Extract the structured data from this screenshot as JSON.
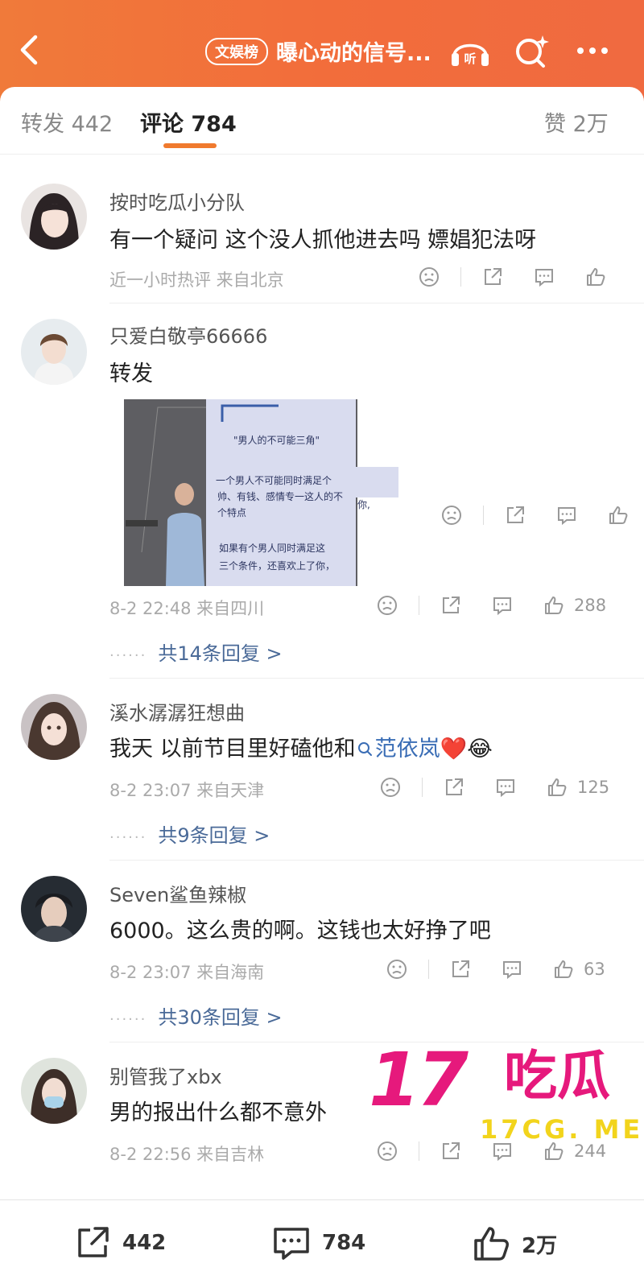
{
  "header": {
    "tag": "文娱榜",
    "title": "曝心动的信号...",
    "listen_label": "听"
  },
  "tabs": {
    "repost": "转发 442",
    "comments": "评论 784",
    "likes": "赞 2万"
  },
  "comments": [
    {
      "user": "按时吃瓜小分队",
      "text": "有一个疑问 这个没人抓他进去吗 嫖娼犯法呀",
      "meta": "近一小时热评  来自北京",
      "likes": ""
    },
    {
      "user": "只爱白敬亭66666",
      "text": "转发",
      "meta": "8-2 22:48  来自四川",
      "likes": "288",
      "replies": "共14条回复 >",
      "image": {
        "heading": "\"男人的不可能三角\"",
        "line1": "一个男人不可能同时满足个",
        "line2": "帅、有钱、感情专一这人的不",
        "line3": "个特点",
        "line3b": "你,",
        "line4": "如果有个男人同时满足这",
        "line5": "三个条件，还喜欢上了你，"
      }
    },
    {
      "user": "溪水潺潺狂想曲",
      "text_prefix": "我天  以前节目里好磕他和",
      "topic": "范依岚",
      "emoji": "❤️😂",
      "meta": "8-2 23:07  来自天津",
      "likes": "125",
      "replies": "共9条回复 >"
    },
    {
      "user": "Seven鲨鱼辣椒",
      "text": "6000。这么贵的啊。这钱也太好挣了吧",
      "meta": "8-2 23:07  来自海南",
      "likes": "63",
      "replies": "共30条回复 >"
    },
    {
      "user": "别管我了xbx",
      "text": "男的报出什么都不意外",
      "meta": "8-2 22:56  来自吉林",
      "likes": "244"
    }
  ],
  "bottom": {
    "reposts": "442",
    "comments": "784",
    "likes": "2万"
  },
  "watermark": {
    "number": "17",
    "cn": "吃瓜",
    "site": "17CG. ME"
  },
  "colors": {
    "header": "#f07a3a",
    "accent": "#f07a2e",
    "link": "#4a6a98",
    "watermark_pink": "#e6197c",
    "watermark_yellow": "#f2d41c"
  }
}
